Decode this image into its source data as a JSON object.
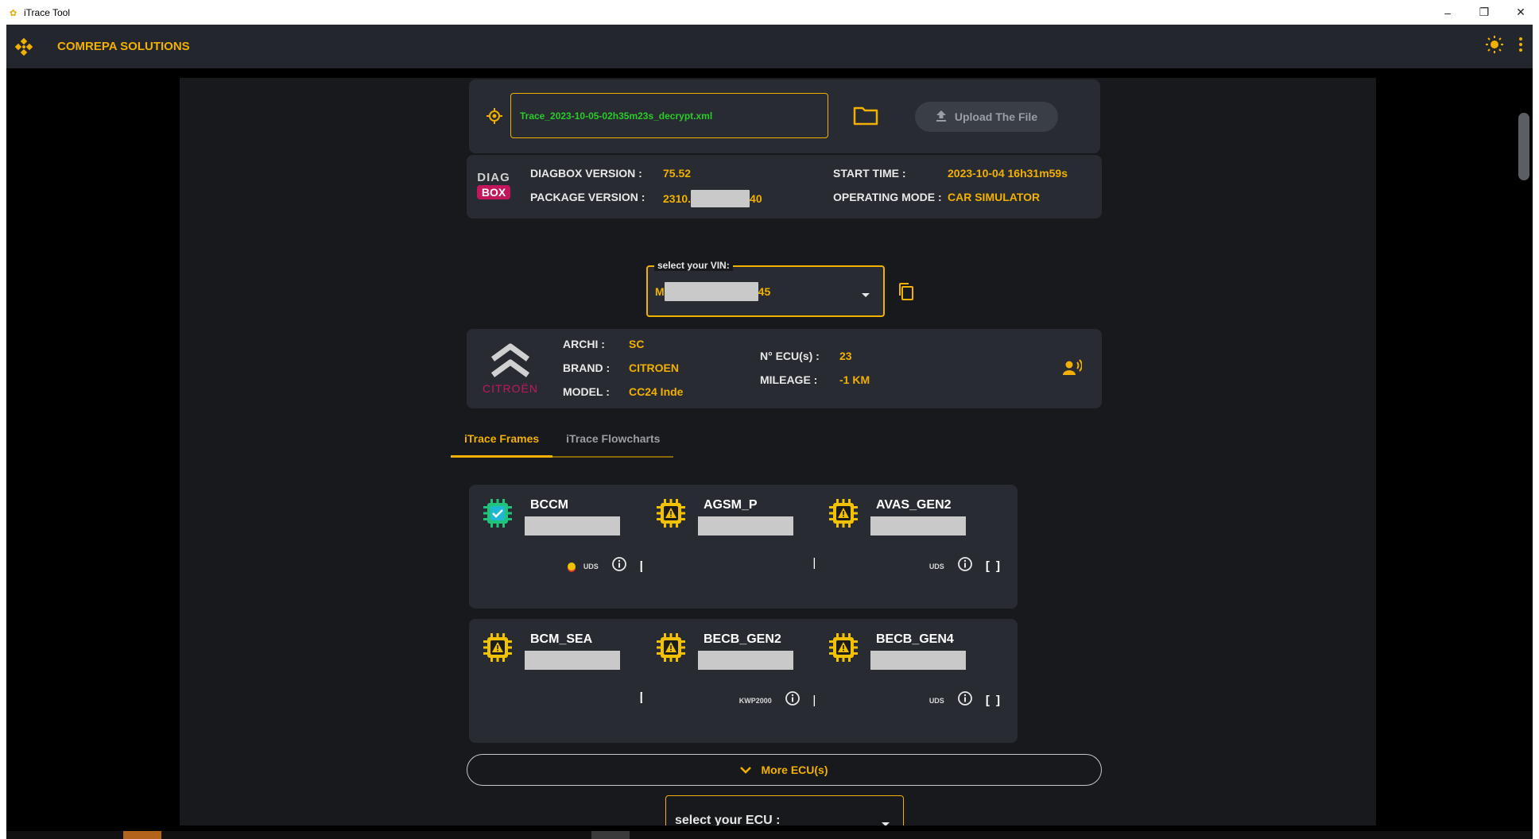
{
  "window": {
    "title": "iTrace Tool",
    "controls": [
      "–",
      "❐",
      "✕"
    ]
  },
  "appbar": {
    "brand": "COMREPA SOLUTIONS"
  },
  "file": {
    "name": "Trace_2023-10-05-02h35m23s_decrypt.xml",
    "upload_label": "Upload The File"
  },
  "diag": {
    "logo_top": "DIAG",
    "logo_bottom": "BOX",
    "diagbox_label": "DIAGBOX VERSION :",
    "diagbox_value": "75.52",
    "package_label": "PACKAGE VERSION :",
    "package_prefix": "2310.",
    "package_suffix": "40",
    "start_label": "START TIME :",
    "start_value": "2023-10-04 16h31m59s",
    "mode_label": "OPERATING MODE :",
    "mode_value": "CAR SIMULATOR"
  },
  "vin": {
    "legend": "select your VIN:",
    "prefix": "M",
    "suffix": "45"
  },
  "vehicle": {
    "brand_logo_text": "CITROËN",
    "archi_label": "ARCHI :",
    "archi_value": "SC",
    "brand_label": "BRAND :",
    "brand_value": "CITROEN",
    "model_label": "MODEL :",
    "model_value": "CC24 Inde",
    "ecu_count_label": "N° ECU(s) :",
    "ecu_count_value": "23",
    "mileage_label": "MILEAGE :",
    "mileage_value": "-1 KM"
  },
  "tabs": [
    {
      "label": "iTrace Frames",
      "active": true
    },
    {
      "label": "iTrace Flowcharts",
      "active": false
    }
  ],
  "ecus": [
    {
      "name": "BCCM",
      "status": "ok",
      "protocol": "UDS",
      "dot": true,
      "info": true,
      "brackets": "[ ]"
    },
    {
      "name": "AGSM_P",
      "status": "warn",
      "protocol": "",
      "dot": false,
      "info": false,
      "brackets": "[ ]"
    },
    {
      "name": "AVAS_GEN2",
      "status": "warn",
      "protocol": "UDS",
      "dot": false,
      "info": true,
      "brackets": "[ ]"
    },
    {
      "name": "BCM_SEA",
      "status": "warn",
      "protocol": "",
      "dot": false,
      "info": false,
      "brackets": "[ ]"
    },
    {
      "name": "BECB_GEN2",
      "status": "warn",
      "protocol": "KWP2000",
      "dot": false,
      "info": true,
      "brackets": "[ ]"
    },
    {
      "name": "BECB_GEN4",
      "status": "warn",
      "protocol": "UDS",
      "dot": false,
      "info": true,
      "brackets": "[ ]"
    }
  ],
  "more_ecus": {
    "label": "More ECU(s)"
  },
  "ecu_select": {
    "label": "select your ECU :"
  },
  "colors": {
    "accent": "#f2b100",
    "ok": "#1fc47a",
    "warn": "#f2c200",
    "file_text": "#29cc29"
  },
  "icons": [
    "app-logo-icon",
    "crosshair-icon",
    "folder-icon",
    "upload-icon",
    "copy-icon",
    "dropdown-arrow-icon",
    "voice-icon",
    "info-icon",
    "theme-sun-icon",
    "more-vert-icon",
    "chevron-down-icon"
  ]
}
